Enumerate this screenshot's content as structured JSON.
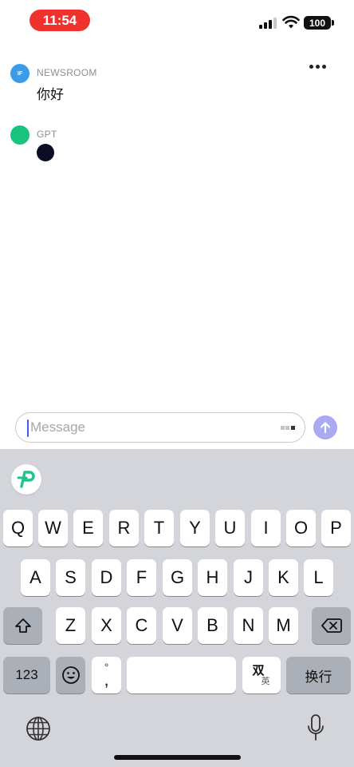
{
  "status_bar": {
    "time": "11:54",
    "battery": "100"
  },
  "chat": {
    "messages": [
      {
        "sender": "NEWSROOM",
        "avatar_text": "IF",
        "avatar_color": "#3a9ce8",
        "text": "你好"
      },
      {
        "sender": "GPT",
        "avatar_text": "",
        "avatar_color": "#19c37d",
        "text": ""
      }
    ]
  },
  "composer": {
    "placeholder": "Message"
  },
  "keyboard": {
    "row1": [
      "Q",
      "W",
      "E",
      "R",
      "T",
      "Y",
      "U",
      "I",
      "O",
      "P"
    ],
    "row2": [
      "A",
      "S",
      "D",
      "F",
      "G",
      "H",
      "J",
      "K",
      "L"
    ],
    "row3": [
      "Z",
      "X",
      "C",
      "V",
      "B",
      "N",
      "M"
    ],
    "numbers_label": "123",
    "punct_top": "°",
    "punct_bottom": ",",
    "mode_top": "双",
    "mode_bottom": "英",
    "return_label": "换行"
  },
  "icons": {
    "more": "ellipsis-icon",
    "send": "arrow-up-icon",
    "shift": "shift-icon",
    "delete": "backspace-icon",
    "emoji": "emoji-icon",
    "globe": "globe-icon",
    "mic": "microphone-icon",
    "logo": "app-logo-icon"
  },
  "colors": {
    "send_button": "#a9aaf2",
    "time_pill": "#f0322f",
    "caret": "#3b5bfd"
  }
}
